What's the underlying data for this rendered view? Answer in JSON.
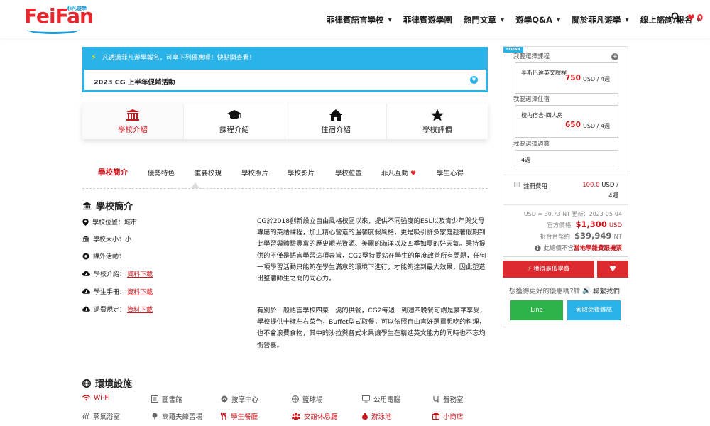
{
  "header": {
    "logo_text": "FeiFan",
    "logo_sub": "菲凡遊學",
    "nav": [
      {
        "label": "菲律賓語言學校",
        "caret": true
      },
      {
        "label": "菲律賓遊學團",
        "caret": false
      },
      {
        "label": "熱門文章",
        "caret": true
      },
      {
        "label": "遊學Q&A",
        "caret": true
      },
      {
        "label": "關於菲凡遊學",
        "caret": true
      },
      {
        "label": "線上諮詢/報名",
        "caret": true
      }
    ],
    "heart_count": "0"
  },
  "promo": {
    "headline": "凡透過菲凡遊學報名，可享下列優惠喔！快點開查看！",
    "item": "2023 CG 上半年促銷活動"
  },
  "cards": [
    {
      "label": "學校介紹",
      "icon": "school-icon",
      "active": true
    },
    {
      "label": "課程介紹",
      "icon": "graduation-cap-icon",
      "active": false
    },
    {
      "label": "住宿介紹",
      "icon": "home-icon",
      "active": false
    },
    {
      "label": "學校評價",
      "icon": "star-icon",
      "active": false
    }
  ],
  "subtabs": [
    {
      "label": "學校簡介",
      "active": true
    },
    {
      "label": "優勢特色"
    },
    {
      "label": "重要校規"
    },
    {
      "label": "學校照片"
    },
    {
      "label": "學校影片"
    },
    {
      "label": "學校位置"
    },
    {
      "label": "菲凡互動"
    },
    {
      "label": "學生心得"
    }
  ],
  "intro": {
    "title": "學校簡介",
    "location_label": "學校位置：",
    "location_value": "城市",
    "size_label": "學校大小：",
    "size_value": "小",
    "activities_label": "課外活動：",
    "brochure_label": "學校介紹：",
    "handbook_label": "學生手冊：",
    "refund_label": "退費規定：",
    "download_text": "資料下載",
    "paragraph1": "CG於2018創新設立自由風格校區以來，提供不同強度的ESL以及青少年與父母專屬的英語課程，加上精心營造的溫馨度假風格，更是吸引許多家庭趁著假期到此學習與體驗豐富的歷史觀光資源、美麗的海洋以及四季如夏的好天氣。秉持提供的不僅是語言學習這項表旨，CG2堅持要站在學生的角度改善所有問題，任何一項學習活動只能夠在學生滿意的環境下進行，才能夠達到最大效果，因此塑造出整體師生之間的向心力。",
    "paragraph2": "有別於一般語言學校四菜一湯的供餐，CG2每週一到週四晚餐可謂是豪華享受，學校提供十樣左右菜色，Buffet型式取餐，可以依照自由喜好選擇想吃的料理，也不會浪費食物，其中的沙拉與各式水果讓學生在精進英文能力的同時也不忘均衡營養。"
  },
  "facilities": {
    "title": "環境設施",
    "items": [
      {
        "label": "Wi-Fi",
        "icon": "wifi-icon",
        "available": true
      },
      {
        "label": "圖書館",
        "icon": "library-icon",
        "available": false
      },
      {
        "label": "按摩中心",
        "icon": "massage-icon",
        "available": false
      },
      {
        "label": "籃球場",
        "icon": "basketball-icon",
        "available": false
      },
      {
        "label": "公用電腦",
        "icon": "computer-icon",
        "available": false
      },
      {
        "label": "醫務室",
        "icon": "medical-icon",
        "available": false
      },
      {
        "label": "蒸氣浴室",
        "icon": "sauna-icon",
        "available": false
      },
      {
        "label": "高爾夫練習場",
        "icon": "golf-icon",
        "available": false
      },
      {
        "label": "學生餐廳",
        "icon": "restaurant-icon",
        "available": true
      },
      {
        "label": "交誼休息廳",
        "icon": "lounge-icon",
        "available": true
      },
      {
        "label": "游泳池",
        "icon": "pool-icon",
        "available": true
      },
      {
        "label": "小商店",
        "icon": "shop-icon",
        "available": true
      }
    ]
  },
  "sidebar": {
    "tag": "FEIFAN",
    "course_label": "我要選擇課程",
    "course_name": "半斯巴達英文課程",
    "course_price": "750",
    "course_unit": "USD / 4週",
    "room_label": "我要選擇住宿",
    "room_name": "校內宿舍-四人房",
    "room_price": "650",
    "room_unit": "USD / 4週",
    "weeks_label": "我要選擇週數",
    "weeks_value": "4週",
    "fee_label": "註冊費用",
    "fee_amount": "100.0",
    "fee_currency": "USD /",
    "fee_period": "4週",
    "rate_text": "USD = 30.73 NT 更新：2023-05-04",
    "official_label": "官方價格",
    "official_value": "$1,300",
    "official_currency": "USD",
    "twd_label": "折合台幣約",
    "twd_value": "$39,949",
    "twd_currency": "NT",
    "note_text": "此總價不含",
    "note_red": "當地學雜費跟機票",
    "cta_label": "獲得最低學費",
    "contact_text": "想獲得更好的優惠嗎?請",
    "contact_us": "聯繫我們",
    "line_label": "Line",
    "quote_label": "索取免費雜誌"
  },
  "colors": {
    "brand_red": "#e8262d",
    "accent_blue": "#2ab3e8",
    "line_green": "#2db349"
  }
}
